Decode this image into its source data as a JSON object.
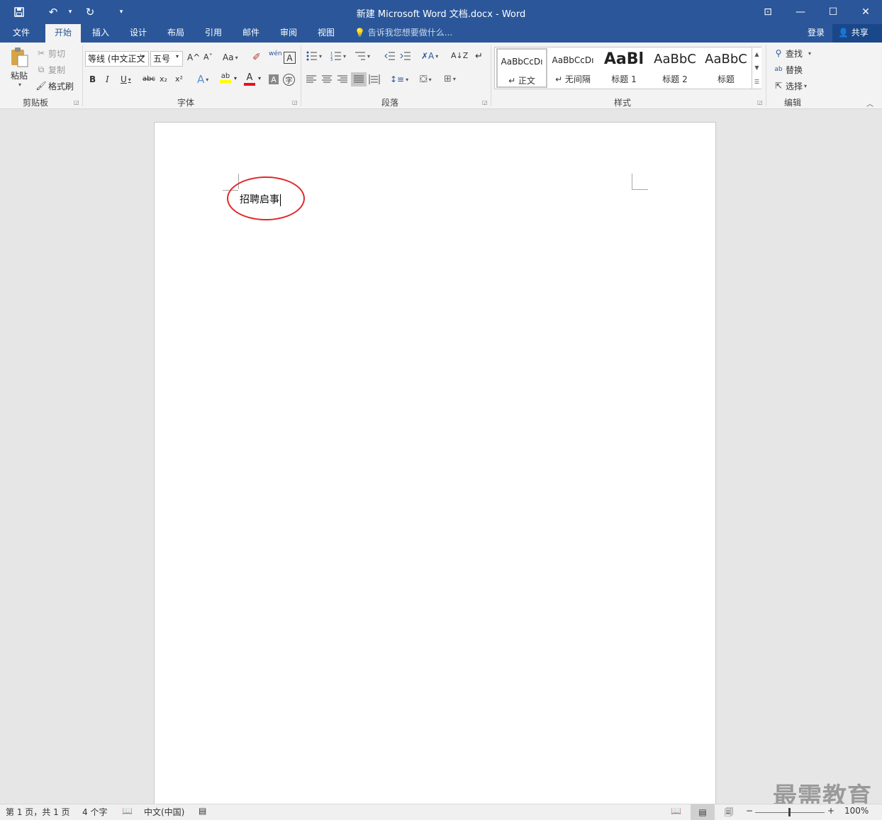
{
  "window": {
    "title": "新建 Microsoft Word 文档.docx - Word",
    "qat": {
      "save_icon": "💾",
      "undo_icon": "↶",
      "redo_icon": "↻",
      "customize_icon": "▾"
    },
    "controls": {
      "ribbon_display": "⊡",
      "minimize": "—",
      "maximize": "☐",
      "close": "✕"
    }
  },
  "tabs": [
    {
      "label": "文件"
    },
    {
      "label": "开始"
    },
    {
      "label": "插入"
    },
    {
      "label": "设计"
    },
    {
      "label": "布局"
    },
    {
      "label": "引用"
    },
    {
      "label": "邮件"
    },
    {
      "label": "审阅"
    },
    {
      "label": "视图"
    }
  ],
  "tellme": "告诉我您想要做什么...",
  "signin": "登录",
  "share": "共享",
  "clipboard": {
    "paste": "粘贴",
    "cut": "剪切",
    "copy": "复制",
    "format_painter": "格式刷",
    "group": "剪贴板"
  },
  "font": {
    "name": "等线 (中文正文",
    "size": "五号",
    "grow": "A^",
    "shrink": "Aˇ",
    "change_case": "Aa",
    "clear": "✐",
    "phonetic": "wén",
    "border": "A",
    "bold": "B",
    "italic": "I",
    "underline": "U",
    "strike": "abc",
    "subscript": "x₂",
    "superscript": "x²",
    "text_effects": "A",
    "highlight": "ab",
    "font_color": "A",
    "char_shading": "A",
    "enclose": "字",
    "group": "字体"
  },
  "paragraph": {
    "group": "段落"
  },
  "styles": {
    "group": "样式",
    "items": [
      {
        "sample": "AaBbCcDı",
        "name": "↵ 正文"
      },
      {
        "sample": "AaBbCcDı",
        "name": "↵ 无间隔"
      },
      {
        "sample": "AaBl",
        "name": "标题 1"
      },
      {
        "sample": "AaBbC",
        "name": "标题 2"
      },
      {
        "sample": "AaBbC",
        "name": "标题"
      }
    ]
  },
  "editing": {
    "find": "查找",
    "replace": "替换",
    "select": "选择",
    "group": "编辑"
  },
  "document": {
    "text": "招聘启事"
  },
  "watermark": "最需教育",
  "status": {
    "page": "第 1 页，共 1 页",
    "words": "4 个字",
    "language": "中文(中国)",
    "zoom": "100%",
    "zoom_level_percent": 100
  },
  "colors": {
    "accent": "#2b579a",
    "highlight_ellipse": "#e0262a",
    "highlight_yellow": "#ffff00",
    "font_red": "#e81123"
  }
}
